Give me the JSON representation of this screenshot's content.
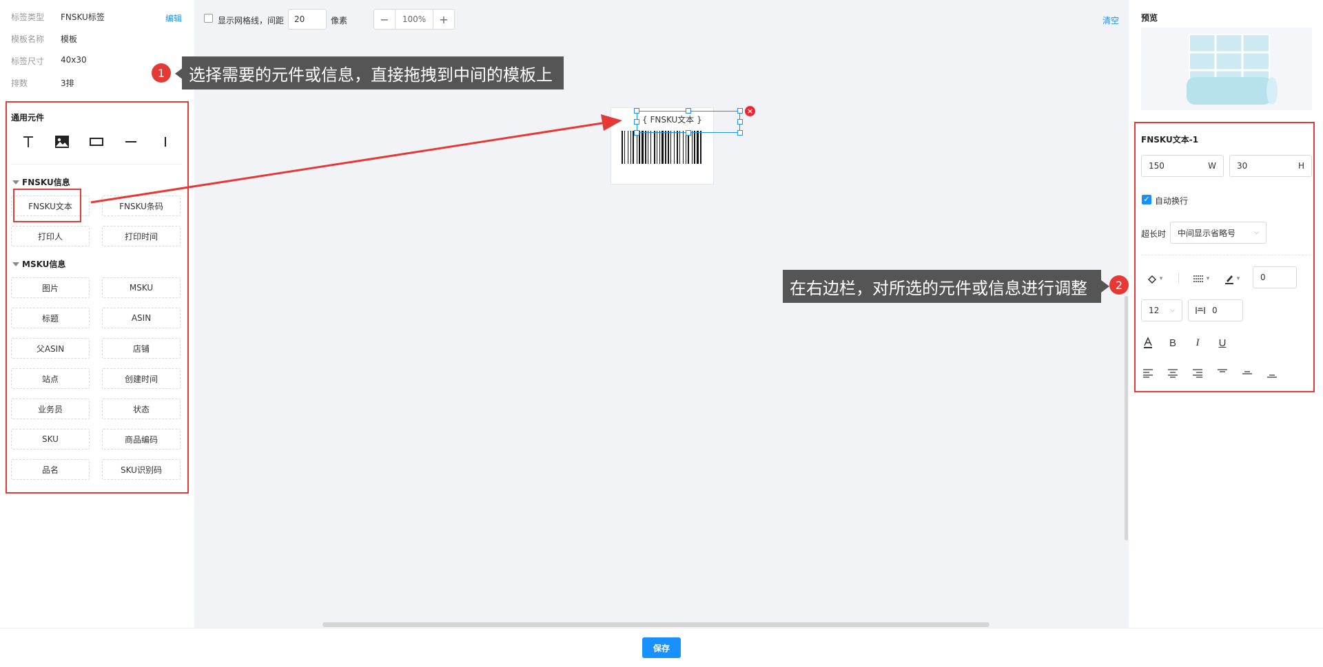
{
  "info": {
    "rows": [
      {
        "key": "标签类型",
        "value": "FNSKU标签"
      },
      {
        "key": "模板名称",
        "value": "模板"
      },
      {
        "key": "标签尺寸",
        "value": "40x30"
      },
      {
        "key": "排数",
        "value": "3排"
      }
    ],
    "edit_label": "编辑"
  },
  "common": {
    "title": "通用元件",
    "tools": [
      "text-tool-icon",
      "image-tool-icon",
      "rect-tool-icon",
      "hline-tool-icon",
      "vline-tool-icon"
    ]
  },
  "fnsku_group": {
    "title": "FNSKU信息",
    "items": [
      "FNSKU文本",
      "FNSKU条码",
      "打印人",
      "打印时间"
    ]
  },
  "msku_group": {
    "title": "MSKU信息",
    "items": [
      "图片",
      "MSKU",
      "标题",
      "ASIN",
      "父ASIN",
      "店铺",
      "站点",
      "创建时间",
      "业务员",
      "状态",
      "SKU",
      "商品编码",
      "品名",
      "SKU识别码"
    ]
  },
  "toolbar": {
    "grid_label": "显示网格线，间距",
    "grid_value": "20",
    "unit": "像素",
    "zoom_minus": "−",
    "zoom_value": "100%",
    "zoom_plus": "+",
    "clear_label": "清空"
  },
  "canvas": {
    "selected_text": "{ FNSKU文本 }",
    "close_glyph": "×"
  },
  "callouts": [
    {
      "num": "1",
      "text": "选择需要的元件或信息，直接拖拽到中间的模板上"
    },
    {
      "num": "2",
      "text": "在右边栏，对所选的元件或信息进行调整"
    }
  ],
  "right": {
    "preview_title": "预览",
    "element_title": "FNSKU文本-1",
    "width_value": "150",
    "width_unit": "W",
    "height_value": "30",
    "height_unit": "H",
    "wrap_label": "自动换行",
    "overflow_label": "超长时",
    "overflow_value": "中间显示省略号",
    "border_width": "0",
    "font_size": "12",
    "letter_spacing": "0"
  },
  "footer": {
    "save_label": "保存"
  },
  "colors": {
    "accent": "#1890ff",
    "callout_red": "#e53935",
    "callout_bg": "#555555",
    "canvas_bg": "#f2f3f7"
  }
}
